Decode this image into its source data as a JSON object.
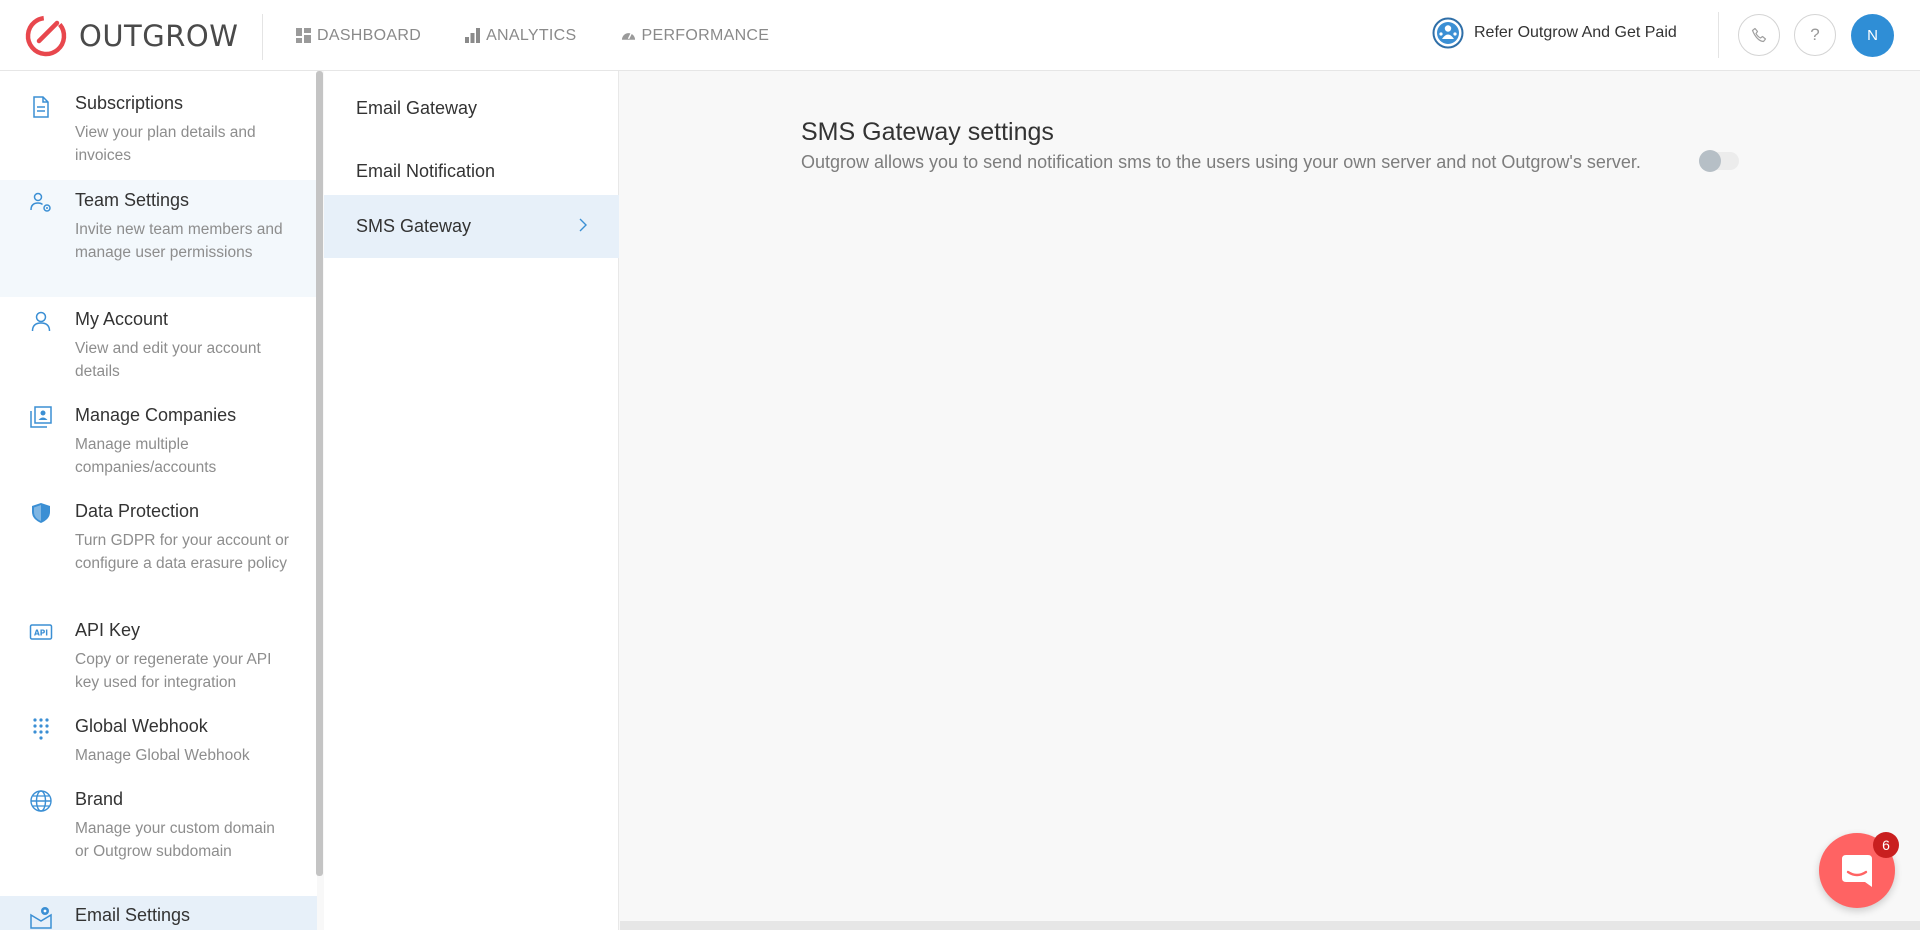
{
  "app": {
    "logo_text": "OUTGROW"
  },
  "nav": {
    "dashboard": "DASHBOARD",
    "analytics": "ANALYTICS",
    "performance": "PERFORMANCE"
  },
  "header": {
    "refer_label": "Refer Outgrow And Get Paid",
    "help_symbol": "?",
    "avatar_initial": "N"
  },
  "sidebar": {
    "items": [
      {
        "title": "Subscriptions",
        "desc": "View your plan details and invoices"
      },
      {
        "title": "Team Settings",
        "desc": "Invite new team members and manage user permissions"
      },
      {
        "title": "My Account",
        "desc": "View and edit your account details"
      },
      {
        "title": "Manage Companies",
        "desc": "Manage multiple companies/accounts"
      },
      {
        "title": "Data Protection",
        "desc": "Turn GDPR for your account or configure a data erasure policy"
      },
      {
        "title": "API Key",
        "desc": "Copy or regenerate your API key used for integration"
      },
      {
        "title": "Global Webhook",
        "desc": "Manage Global Webhook"
      },
      {
        "title": "Brand",
        "desc": "Manage your custom domain or Outgrow subdomain"
      },
      {
        "title": "Email Settings",
        "desc": ""
      }
    ]
  },
  "submenu": {
    "items": [
      {
        "label": "Email Gateway"
      },
      {
        "label": "Email Notification"
      },
      {
        "label": "SMS Gateway"
      }
    ]
  },
  "main": {
    "title": "SMS Gateway settings",
    "description": "Outgrow allows you to send notification sms to the users using your own server and not Outgrow's server.",
    "toggle_on": false
  },
  "chat": {
    "badge_count": "6"
  },
  "colors": {
    "brand_red": "#e8474d",
    "accent_blue": "#2f8ed6",
    "icon_blue": "#3b8fd4",
    "active_bg": "#e7f0f9",
    "chat_red": "#ff6363"
  }
}
